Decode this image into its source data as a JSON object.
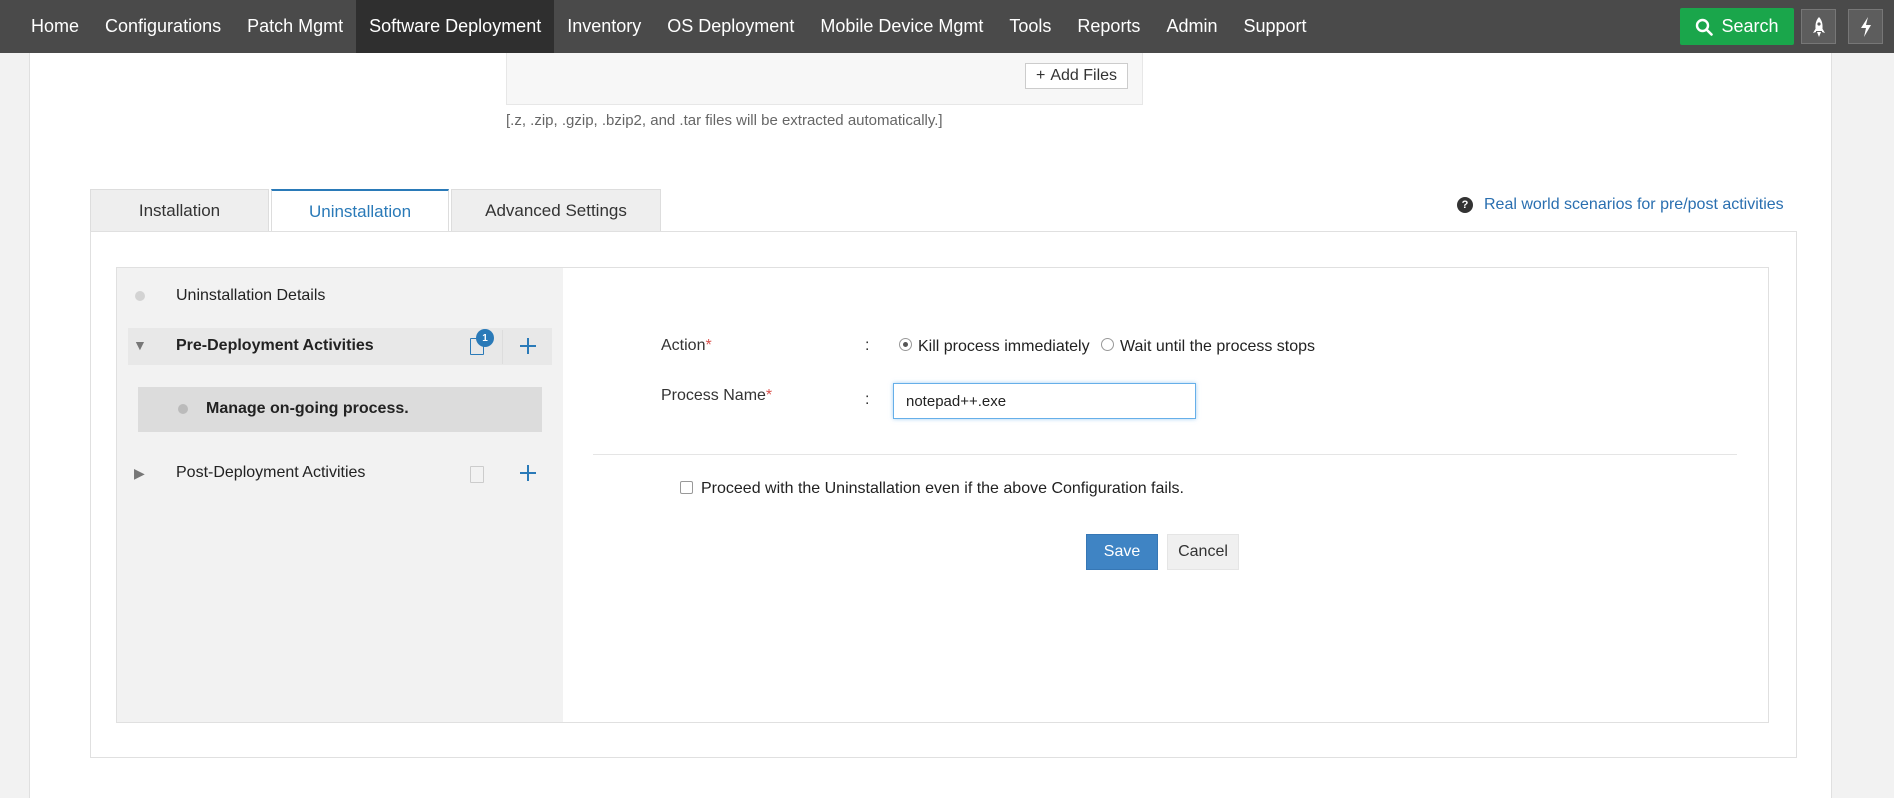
{
  "nav": {
    "items": [
      {
        "label": "Home",
        "active": false
      },
      {
        "label": "Configurations",
        "active": false
      },
      {
        "label": "Patch Mgmt",
        "active": false
      },
      {
        "label": "Software Deployment",
        "active": true
      },
      {
        "label": "Inventory",
        "active": false
      },
      {
        "label": "OS Deployment",
        "active": false
      },
      {
        "label": "Mobile Device Mgmt",
        "active": false
      },
      {
        "label": "Tools",
        "active": false
      },
      {
        "label": "Reports",
        "active": false
      },
      {
        "label": "Admin",
        "active": false
      },
      {
        "label": "Support",
        "active": false
      }
    ],
    "search_label": "Search",
    "colors": {
      "bar": "#4a4a4a",
      "active": "#2f2f2f",
      "search": "#1aa64b"
    }
  },
  "upload": {
    "add_files_label": "Add Files",
    "hint": "[.z, .zip, .gzip, .bzip2, and .tar files will be extracted automatically.]"
  },
  "tabs": [
    {
      "label": "Installation",
      "active": false
    },
    {
      "label": "Uninstallation",
      "active": true
    },
    {
      "label": "Advanced Settings",
      "active": false
    }
  ],
  "help_link": "Real world scenarios for pre/post activities",
  "steps": {
    "details": "Uninstallation Details",
    "pre": "Pre-Deployment Activities",
    "pre_count": "1",
    "pre_child": "Manage on-going process.",
    "post": "Post-Deployment Activities"
  },
  "form": {
    "action_label": "Action",
    "required_mark": "*",
    "separator": ":",
    "action_options": [
      {
        "label": "Kill process immediately",
        "checked": true
      },
      {
        "label": "Wait until the process stops",
        "checked": false
      }
    ],
    "process_name_label": "Process Name",
    "process_name_value": "notepad++.exe",
    "proceed_label": "Proceed with the Uninstallation even if the above Configuration fails.",
    "proceed_checked": false,
    "save_label": "Save",
    "cancel_label": "Cancel"
  },
  "accent_color": "#2a7ab8"
}
